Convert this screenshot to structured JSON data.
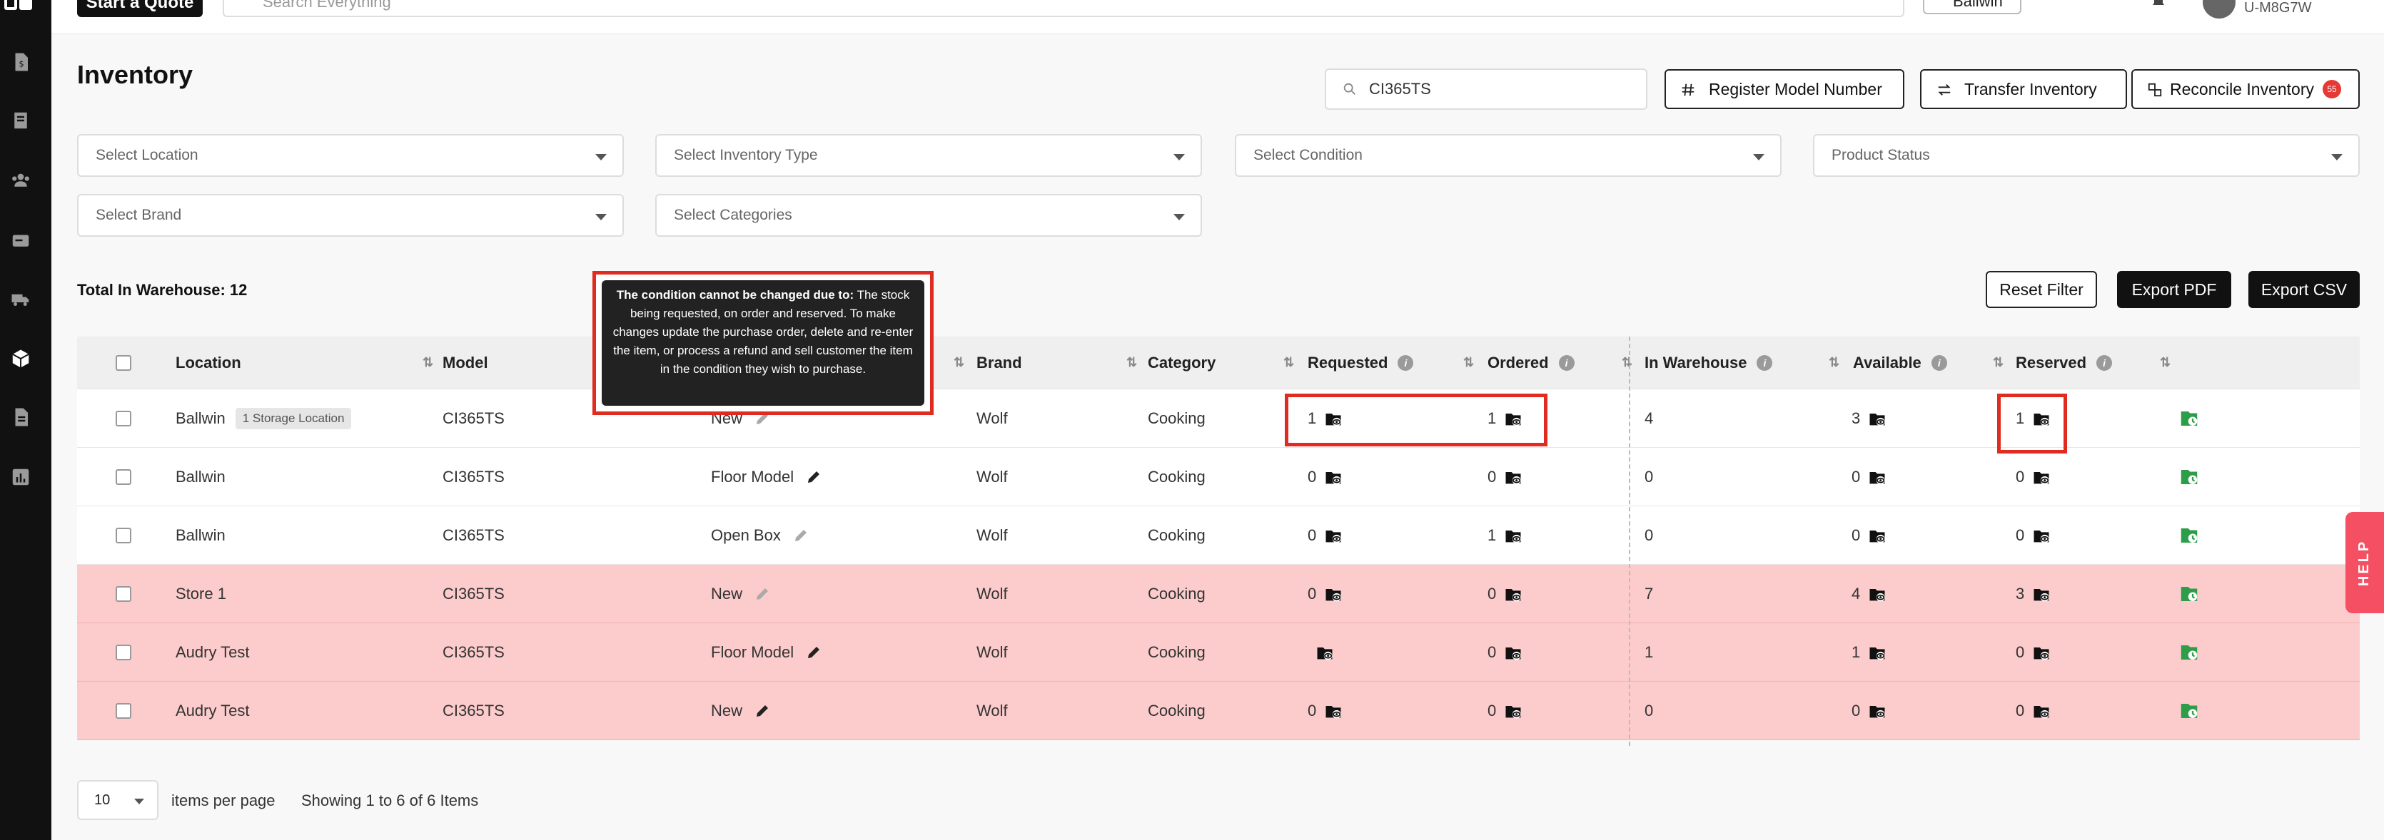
{
  "topbar": {
    "start_quote": "Start a Quote",
    "search_placeholder": "Search Everything",
    "store": "Ballwin",
    "user_code": "U-M8G7W"
  },
  "page": {
    "title": "Inventory",
    "search_value": "CI365TS",
    "register_label": "Register Model Number",
    "transfer_label": "Transfer Inventory",
    "reconcile_label": "Reconcile Inventory",
    "reconcile_badge": "55"
  },
  "filters": {
    "location": "Select Location",
    "inventory_type": "Select Inventory Type",
    "condition": "Select Condition",
    "product_status": "Product Status",
    "brand": "Select Brand",
    "categories": "Select Categories"
  },
  "total_label": "Total In Warehouse: 12",
  "actions": {
    "reset": "Reset Filter",
    "export_pdf": "Export PDF",
    "export_csv": "Export CSV"
  },
  "tooltip": {
    "bold": "The condition cannot be changed due to:",
    "text": " The stock being requested, on order and reserved. To make changes update the purchase order, delete and re-enter the item, or process a refund and sell customer the item in the condition they wish to purchase."
  },
  "columns": {
    "location": "Location",
    "model": "Model",
    "brand": "Brand",
    "category": "Category",
    "requested": "Requested",
    "ordered": "Ordered",
    "in_warehouse": "In Warehouse",
    "available": "Available",
    "reserved": "Reserved"
  },
  "rows": [
    {
      "location": "Ballwin",
      "loc_badge": "1 Storage Location",
      "model": "CI365TS",
      "condition": "New",
      "brand": "Wolf",
      "category": "Cooking",
      "requested": "1",
      "ordered": "1",
      "in_warehouse": "4",
      "available": "3",
      "reserved": "1"
    },
    {
      "location": "Ballwin",
      "model": "CI365TS",
      "condition": "Floor Model",
      "brand": "Wolf",
      "category": "Cooking",
      "requested": "0",
      "ordered": "0",
      "in_warehouse": "0",
      "available": "0",
      "reserved": "0"
    },
    {
      "location": "Ballwin",
      "model": "CI365TS",
      "condition": "Open Box",
      "brand": "Wolf",
      "category": "Cooking",
      "requested": "0",
      "ordered": "1",
      "in_warehouse": "0",
      "available": "0",
      "reserved": "0"
    },
    {
      "location": "Store 1",
      "model": "CI365TS",
      "condition": "New",
      "brand": "Wolf",
      "category": "Cooking",
      "requested": "0",
      "ordered": "0",
      "in_warehouse": "7",
      "available": "4",
      "reserved": "3"
    },
    {
      "location": "Audry Test",
      "model": "CI365TS",
      "condition": "Floor Model",
      "brand": "Wolf",
      "category": "Cooking",
      "requested": "",
      "ordered": "0",
      "in_warehouse": "1",
      "available": "1",
      "reserved": "0"
    },
    {
      "location": "Audry Test",
      "model": "CI365TS",
      "condition": "New",
      "brand": "Wolf",
      "category": "Cooking",
      "requested": "0",
      "ordered": "0",
      "in_warehouse": "0",
      "available": "0",
      "reserved": "0"
    }
  ],
  "pagination": {
    "per_page_value": "10",
    "per_page_label": "items per page",
    "showing": "Showing 1 to 6 of 6 Items"
  },
  "help_label": "HELP",
  "colors": {
    "highlight": "#e02b20",
    "pink_row": "#fccbcb",
    "green_action": "#2e9d4a"
  }
}
